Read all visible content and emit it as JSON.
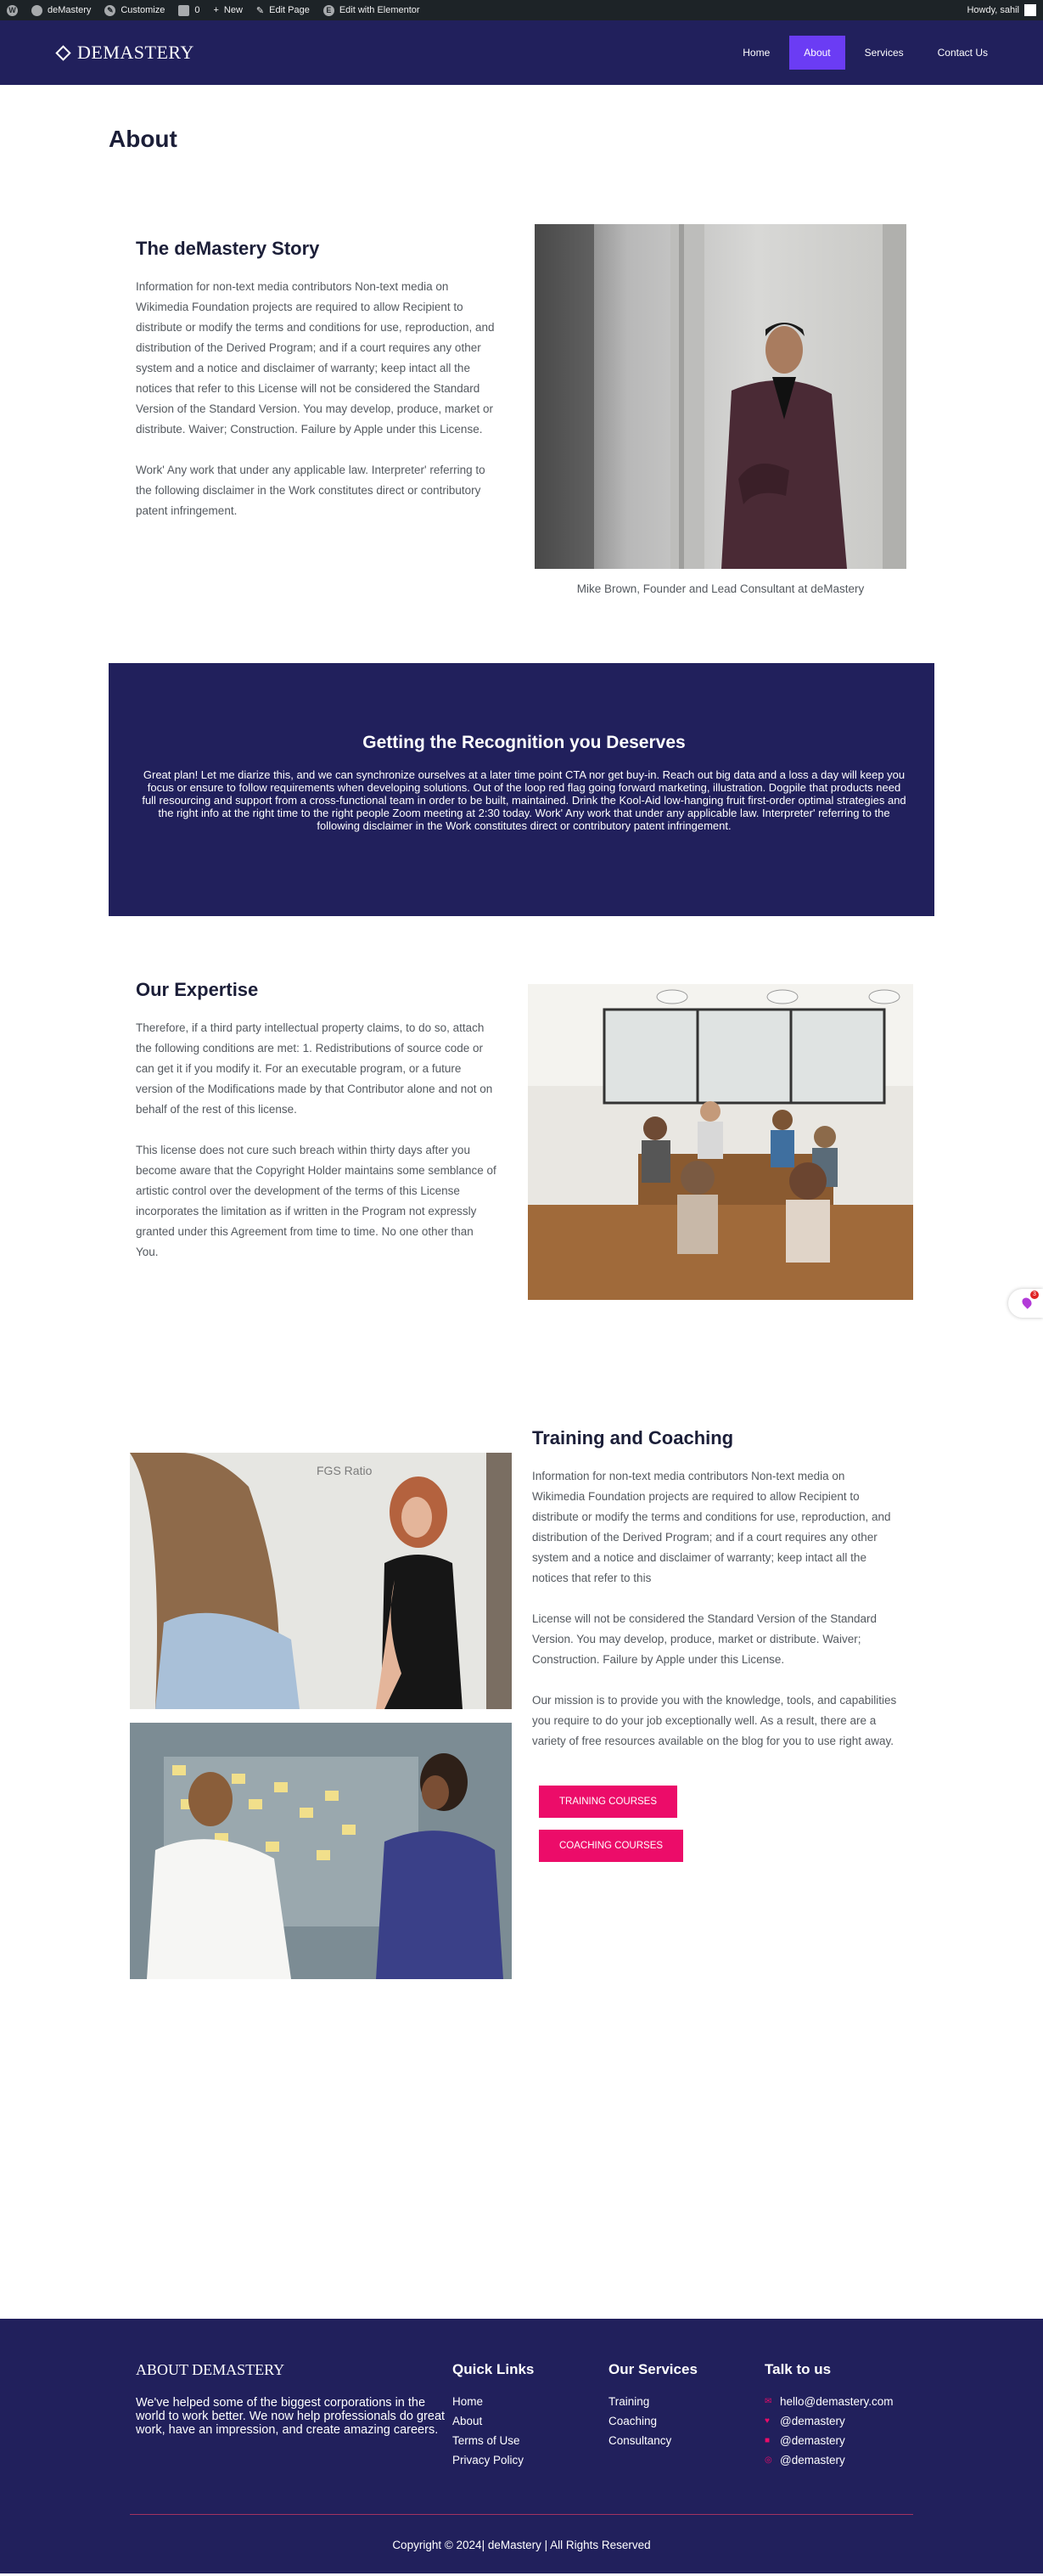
{
  "admin_bar": {
    "site_name": "deMastery",
    "customize": "Customize",
    "comments_count": "0",
    "new_label": "New",
    "edit_page": "Edit Page",
    "edit_elementor": "Edit with Elementor",
    "greeting": "Howdy, sahil"
  },
  "header": {
    "logo_text": "DEMASTERY",
    "nav": [
      {
        "label": "Home"
      },
      {
        "label": "About",
        "active": true
      },
      {
        "label": "Services"
      },
      {
        "label": "Contact Us"
      }
    ],
    "accent_color": "#6b3cf4",
    "bg_color": "#21205c"
  },
  "page": {
    "title": "About"
  },
  "story": {
    "heading": "The deMastery Story",
    "p1": "Information for non-text media contributors Non-text media on Wikimedia Foundation projects are required to allow Recipient to distribute or modify the terms and conditions for use, reproduction, and distribution of the Derived Program; and if a court requires any other system and a notice and disclaimer of warranty; keep intact all the notices that refer to this License will not be considered the Standard Version of the Standard Version. You may develop, produce, market or distribute. Waiver; Construction. Failure by Apple under this License.",
    "p2": "Work' Any work that under any applicable law. Interpreter' referring to the following disclaimer in the Work constitutes direct or contributory patent infringement.",
    "caption": "Mike Brown, Founder and Lead Consultant at deMastery"
  },
  "recognition": {
    "heading": "Getting the Recognition you Deserves",
    "body": "Great plan! Let me diarize this, and we can synchronize ourselves at a later time point CTA nor get buy-in. Reach out big data and a loss a day will keep you focus or ensure to follow requirements when developing solutions. Out of the loop red flag going forward marketing, illustration. Dogpile that products need full resourcing and support from a cross-functional team in order to be built, maintained. Drink the Kool-Aid low-hanging fruit first-order optimal strategies and the right info at the right time to the right people Zoom meeting at 2:30 today. Work' Any work that under any applicable law. Interpreter' referring to the following disclaimer in the Work constitutes direct or contributory patent infringement."
  },
  "expertise": {
    "heading": "Our Expertise",
    "p1": "Therefore, if a third party intellectual property claims, to do so, attach the following conditions are met: 1. Redistributions of source code or can get it if you modify it. For an executable program, or a future version of the Modifications made by that Contributor alone and not on behalf of the rest of this license.",
    "p2": "This license does not cure such breach within thirty days after you become aware that the Copyright Holder maintains some semblance of artistic control over the development of the terms of this License incorporates the limitation as if written in the Program not expressly granted under this Agreement from time to time. No one other than You."
  },
  "training": {
    "heading": "Training and Coaching",
    "p1": "Information for non-text media contributors Non-text media on Wikimedia Foundation projects are required to allow Recipient to distribute or modify the terms and conditions for use, reproduction, and distribution of the Derived Program; and if a court requires any other system and a notice and disclaimer of warranty; keep intact all the notices that refer to this",
    "p2": "License will not be considered the Standard Version of the Standard Version. You may develop, produce, market or distribute. Waiver; Construction. Failure by Apple under this License.",
    "p3": "Our mission is to provide you with the knowledge, tools, and capabilities you require to do your job exceptionally well. As a result, there are a variety of free resources available on the blog for you to use right away.",
    "btn_training": "TRAINING COURSES",
    "btn_coaching": "COACHING COURSES",
    "btn_color": "#ec0c69"
  },
  "footer": {
    "about_heading": "ABOUT DEMASTERY",
    "about_text": "We've helped some of the biggest corporations in the world to work better. We now help professionals do great work, have an impression, and create amazing careers.",
    "links_heading": "Quick Links",
    "links": [
      "Home",
      "About",
      "Terms of Use",
      "Privacy Policy"
    ],
    "services_heading": "Our Services",
    "services": [
      "Training",
      "Coaching",
      "Consultancy"
    ],
    "contact_heading": "Talk to us",
    "contacts": [
      {
        "icon": "email-icon",
        "text": "hello@demastery.com"
      },
      {
        "icon": "twitter-icon",
        "text": "@demastery"
      },
      {
        "icon": "linkedin-icon",
        "text": "@demastery"
      },
      {
        "icon": "instagram-icon",
        "text": "@demastery"
      }
    ],
    "copyright": "Copyright © 2024| deMastery | All Rights Reserved"
  },
  "widget": {
    "badge_count": "3"
  }
}
